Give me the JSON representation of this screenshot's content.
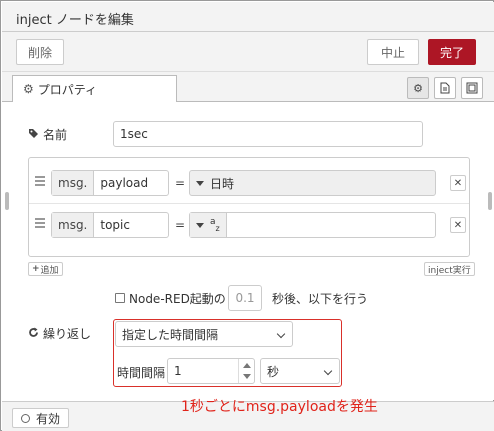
{
  "dialog": {
    "title": "inject ノードを編集",
    "delete_label": "削除",
    "cancel_label": "中止",
    "done_label": "完了",
    "accent": "#ad1625"
  },
  "tabs": {
    "properties_label": "プロパティ",
    "properties_icon": "gear-icon",
    "icons": [
      "gear-icon",
      "document-icon",
      "layout-icon"
    ]
  },
  "name_field": {
    "label": "名前",
    "value": "1sec"
  },
  "props": [
    {
      "type": "msg.",
      "key": "payload",
      "op": "=",
      "value_type": "日時"
    },
    {
      "type": "msg.",
      "key": "topic",
      "op": "=",
      "value_type": "a",
      "value_type_sub": "z"
    }
  ],
  "add_label": "追加",
  "inject_now_label": "inject実行",
  "startup": {
    "label": "Node-RED起動の",
    "delay": "0.1",
    "suffix": "秒後、以下を行う",
    "checked": false
  },
  "repeat": {
    "label": "繰り返し",
    "mode": "指定した時間間隔",
    "interval_label": "時間間隔",
    "interval_value": "1",
    "unit": "秒"
  },
  "annotation": {
    "text": "1秒ごとにmsg.payloadを発生",
    "color": "#e0231a"
  },
  "footer": {
    "enabled_label": "有効"
  }
}
